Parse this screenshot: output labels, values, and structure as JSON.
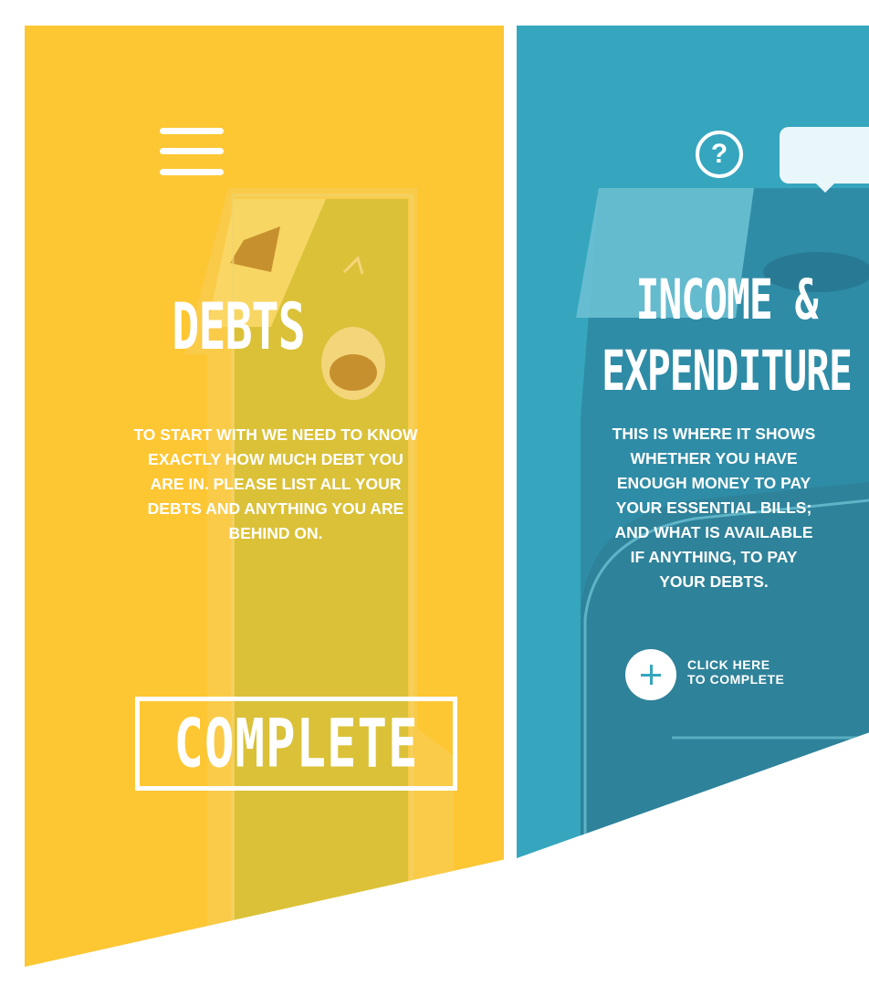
{
  "panels": {
    "debts": {
      "title": "DEBTS",
      "description": "TO START WITH WE NEED TO KNOW EXACTLY HOW MUCH DEBT YOU ARE IN. PLEASE LIST ALL YOUR DEBTS AND ANYTHING YOU ARE BEHIND ON.",
      "status_button": "COMPLETE",
      "step_number": "1",
      "background_color": "#fdc633"
    },
    "income": {
      "title_line1": "INCOME &",
      "title_line2": "EXPENDITURE",
      "description": "THIS IS WHERE IT SHOWS\nWHETHER YOU HAVE\nENOUGH MONEY TO PAY\nYOUR ESSENTIAL BILLS;\nAND WHAT IS AVAILABLE\nIF ANYTHING, TO PAY\nYOUR DEBTS.",
      "add_label": "CLICK HERE\nTO COMPLETE",
      "help_symbol": "?",
      "step_number": "2",
      "background_color": "#35a6be"
    }
  },
  "icons": {
    "menu": "hamburger-icon",
    "help": "question-circle-icon",
    "add": "plus-circle-icon",
    "speech": "speech-bubble-icon"
  }
}
